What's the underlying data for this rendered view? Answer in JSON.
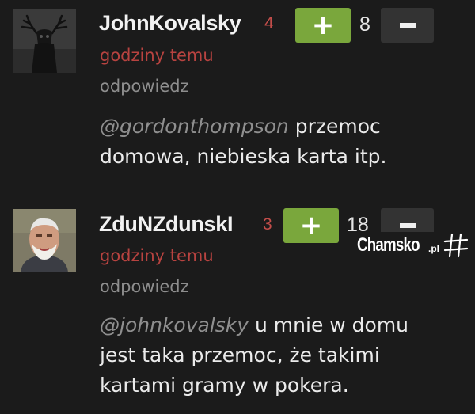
{
  "comments": [
    {
      "username": "JohnKovalsky",
      "score": "4",
      "plus_label": "+",
      "votes": "8",
      "time": "godziny temu",
      "reply": "odpowiedz",
      "mention": "@gordonthompson",
      "text": " przemoc domowa, niebieska karta itp.",
      "avatar_icon": "stag-skull-avatar"
    },
    {
      "username": "ZduNZdunskI",
      "score": "3",
      "plus_label": "+",
      "votes": "18",
      "time": "godziny temu",
      "reply": "odpowiedz",
      "mention": "@johnkovalsky",
      "text": " u mnie w domu jest taka przemoc, że takimi kartami gramy w pokera.",
      "avatar_icon": "old-man-photo-avatar"
    }
  ],
  "watermark": {
    "brand": "Chamsko",
    "domain": ".pl"
  },
  "colors": {
    "background": "#1b1b1b",
    "plus_button": "#7aa73c",
    "minus_button": "#333333",
    "score": "#c24d4a",
    "time": "#b84340",
    "muted": "#8e8e8e"
  }
}
